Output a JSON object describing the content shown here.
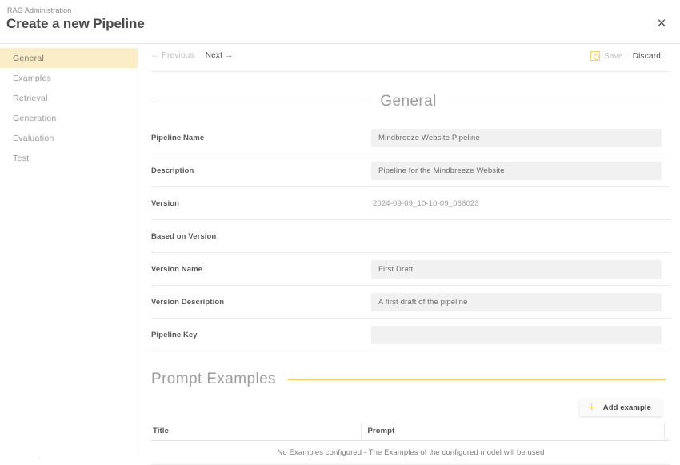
{
  "header": {
    "breadcrumb": "RAG Administration",
    "title": "Create a new Pipeline",
    "close_icon": "close-icon",
    "close_glyph": "✕"
  },
  "sidebar": {
    "items": [
      {
        "label": "General",
        "active": true
      },
      {
        "label": "Examples",
        "active": false
      },
      {
        "label": "Retrieval",
        "active": false
      },
      {
        "label": "Generation",
        "active": false
      },
      {
        "label": "Evaluation",
        "active": false
      },
      {
        "label": "Test",
        "active": false
      }
    ]
  },
  "toolbar": {
    "previous_label": "←  Previous",
    "next_label": "Next  →",
    "save_label": "Save",
    "save_icon": "save-disk-icon",
    "discard_label": "Discard"
  },
  "general_section": {
    "title": "General",
    "fields": [
      {
        "label": "Pipeline Name",
        "value": "Mindbreeze Website Pipeline",
        "kind": "input"
      },
      {
        "label": "Description",
        "value": "Pipeline for the Mindbreeze Website",
        "kind": "input"
      },
      {
        "label": "Version",
        "value": "2024-09-09_10-10-09_066023",
        "kind": "static"
      },
      {
        "label": "Based on Version",
        "value": "",
        "kind": "none"
      },
      {
        "label": "Version Name",
        "value": "First Draft",
        "kind": "input"
      },
      {
        "label": "Version Description",
        "value": "A first draft of the pipeline",
        "kind": "input"
      },
      {
        "label": "Pipeline Key",
        "value": "",
        "kind": "input"
      }
    ]
  },
  "prompt_examples": {
    "title": "Prompt Examples",
    "add_button_label": "Add example",
    "add_button_icon": "plus-icon",
    "add_button_glyph": "＋",
    "columns": [
      "Title",
      "Prompt"
    ],
    "empty_message": "No Examples configured - The Examples of the configured model will be used"
  },
  "colors": {
    "accent_yellow": "#f2d45c",
    "active_item_bg": "#fbedc8",
    "input_bg": "#f1f1f1"
  }
}
